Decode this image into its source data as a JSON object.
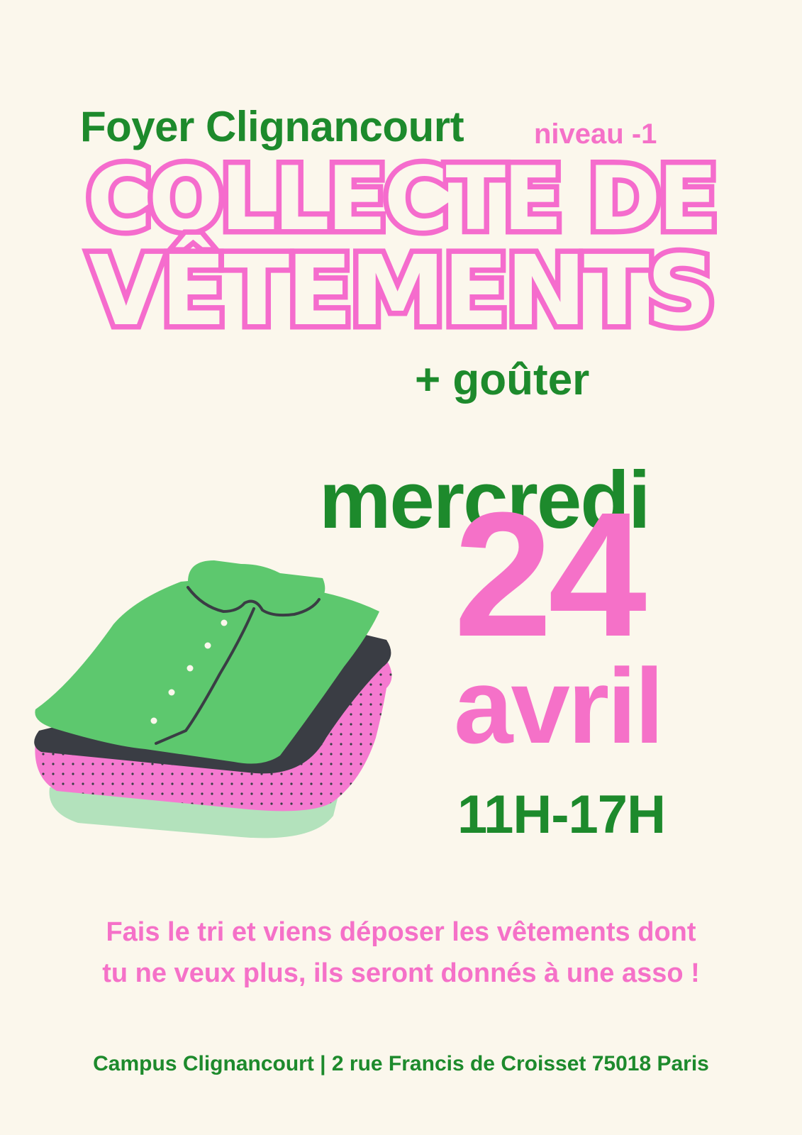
{
  "poster": {
    "venue": "Foyer Clignancourt",
    "level": "niveau -1",
    "title_line1": "COLLECTE DE",
    "title_line2": "VÊTEMENTS",
    "extra": "+ goûter",
    "day": "mercredi",
    "date": "24",
    "month": "avril",
    "hours": "11H-17H",
    "message_line1": "Fais le tri et viens déposer les vêtements dont",
    "message_line2": "tu ne veux plus, ils seront donnés à une asso !",
    "address": "Campus Clignancourt | 2 rue Francis de Croisset 75018 Paris"
  },
  "illustration": {
    "icon": "folded-clothes-icon"
  },
  "colors": {
    "background": "#fbf7ec",
    "green": "#1d8a2c",
    "pink": "#f571c8",
    "shirt_green": "#5dc86e",
    "dark_gray": "#3a3d44",
    "mint": "#b3e2bc"
  }
}
